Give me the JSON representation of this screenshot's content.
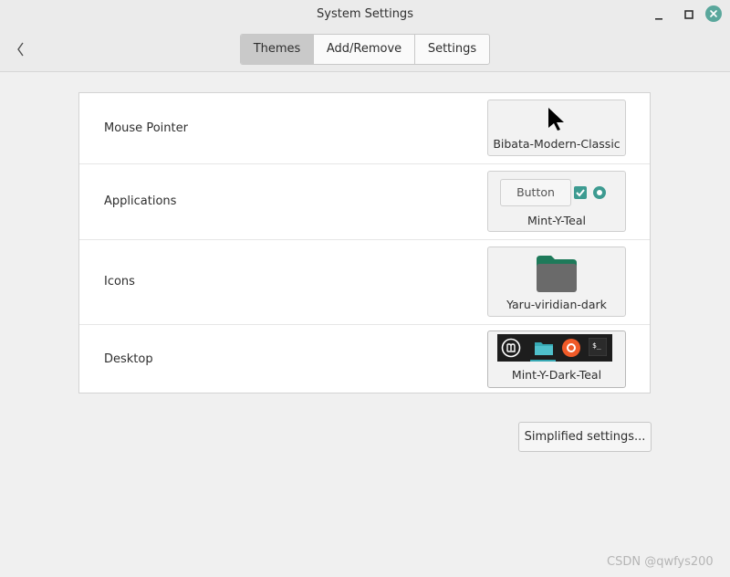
{
  "window": {
    "title": "System Settings"
  },
  "tabs": [
    {
      "label": "Themes",
      "active": true
    },
    {
      "label": "Add/Remove",
      "active": false
    },
    {
      "label": "Settings",
      "active": false
    }
  ],
  "rows": [
    {
      "label": "Mouse Pointer",
      "theme": "Bibata-Modern-Classic",
      "preview": "cursor-arrow-icon"
    },
    {
      "label": "Applications",
      "theme": "Mint-Y-Teal",
      "preview_button": "Button"
    },
    {
      "label": "Icons",
      "theme": "Yaru-viridian-dark",
      "preview": "folder-icon"
    },
    {
      "label": "Desktop",
      "theme": "Mint-Y-Dark-Teal",
      "preview": [
        "mint-menu-icon",
        "files-icon",
        "firefox-icon",
        "terminal-icon"
      ]
    }
  ],
  "simplified_button": "Simplified settings...",
  "watermark": "CSDN @qwfys200",
  "colors": {
    "accent": "#3d9b91",
    "close": "#5aa79c",
    "folder": "#6a6a6a",
    "folder_tab": "#1e7a5a"
  }
}
